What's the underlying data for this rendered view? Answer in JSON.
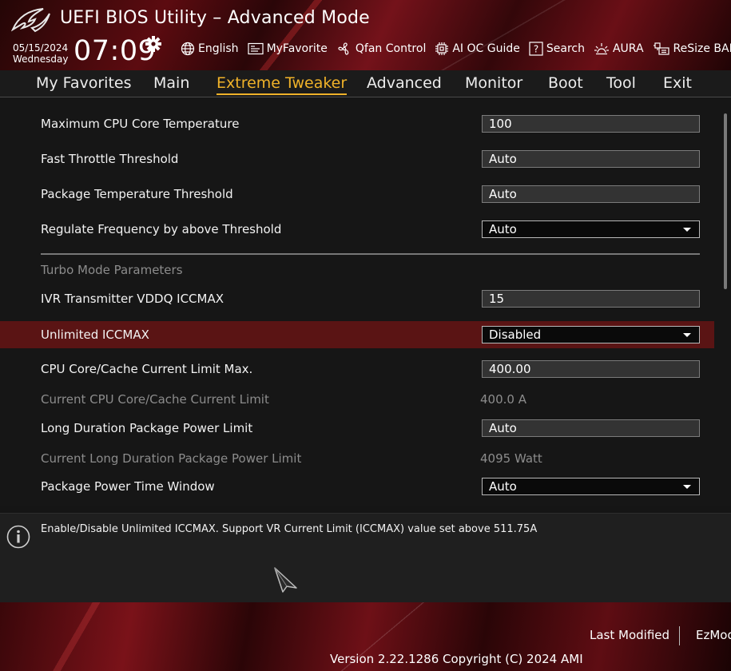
{
  "header": {
    "title": "UEFI BIOS Utility – Advanced Mode",
    "date": "05/15/2024",
    "weekday": "Wednesday",
    "time": "07:09",
    "tools": [
      {
        "label": "English",
        "icon": "globe-icon"
      },
      {
        "label": "MyFavorite",
        "icon": "favorite-icon"
      },
      {
        "label": "Qfan Control",
        "icon": "fan-icon"
      },
      {
        "label": "AI OC Guide",
        "icon": "ai-chip-icon"
      },
      {
        "label": "Search",
        "icon": "search-question-icon"
      },
      {
        "label": "AURA",
        "icon": "aura-icon"
      },
      {
        "label": "ReSize BAR",
        "icon": "resize-bar-icon"
      }
    ]
  },
  "menu": {
    "items": [
      "My Favorites",
      "Main",
      "Extreme Tweaker",
      "Advanced",
      "Monitor",
      "Boot",
      "Tool",
      "Exit"
    ],
    "active": "Extreme Tweaker"
  },
  "settings": {
    "max_cpu_core_temp": {
      "label": "Maximum CPU Core Temperature",
      "value": "100"
    },
    "fast_throttle": {
      "label": "Fast Throttle Threshold",
      "value": "Auto"
    },
    "package_temp": {
      "label": "Package Temperature Threshold",
      "value": "Auto"
    },
    "regulate_freq": {
      "label": "Regulate Frequency by above Threshold",
      "value": "Auto"
    },
    "turbo_section": "Turbo Mode Parameters",
    "ivr_vddq": {
      "label": "IVR Transmitter VDDQ ICCMAX",
      "value": "15"
    },
    "unlimited_iccmax": {
      "label": "Unlimited ICCMAX",
      "value": "Disabled"
    },
    "cpu_current_limit_max": {
      "label": "CPU Core/Cache Current Limit Max.",
      "value": "400.00"
    },
    "current_cpu_limit": {
      "label": "Current CPU Core/Cache Current Limit",
      "value": "400.0 A"
    },
    "long_duration_ppl": {
      "label": "Long Duration Package Power Limit",
      "value": "Auto"
    },
    "current_long_ppl": {
      "label": "Current Long Duration Package Power Limit",
      "value": "4095 Watt"
    },
    "package_power_window": {
      "label": "Package Power Time Window",
      "value": "Auto"
    }
  },
  "help": {
    "text": "Enable/Disable Unlimited ICCMAX. Support VR Current Limit (ICCMAX) value set above 511.75A"
  },
  "footer": {
    "last_modified": "Last Modified",
    "ez_mode": "EzMod",
    "version": "Version 2.22.1286 Copyright (C) 2024 AMI"
  },
  "colors": {
    "accent": "#f0b229",
    "selected_row": "#5a1414",
    "header_red": "#74121a"
  }
}
